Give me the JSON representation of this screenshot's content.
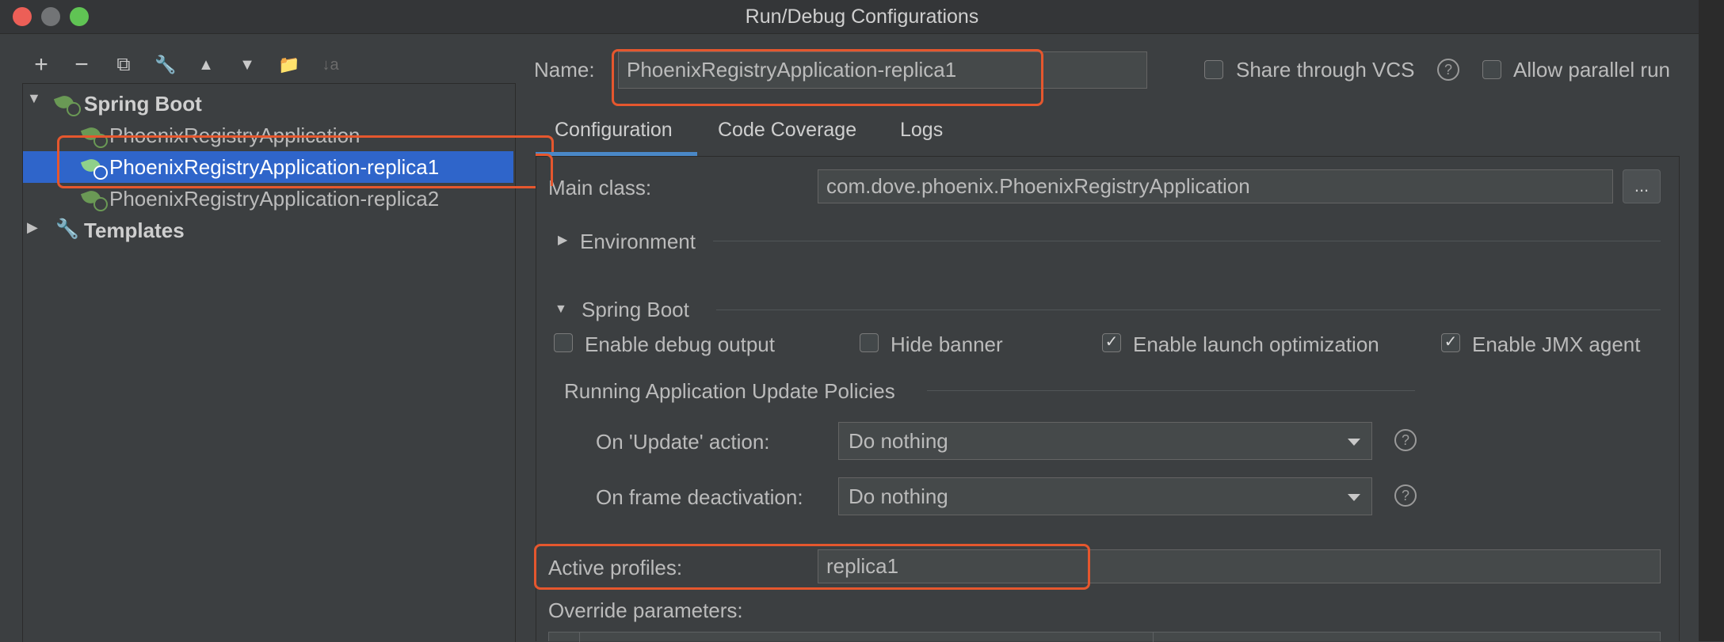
{
  "window": {
    "title": "Run/Debug Configurations"
  },
  "toolbar": {
    "add": "+",
    "remove": "−",
    "copy": "⧉",
    "edit": "🔧",
    "up": "▲",
    "down": "▼",
    "folder": "📁",
    "sort": "↓a"
  },
  "tree": {
    "spring_boot": "Spring Boot",
    "items": [
      "PhoenixRegistryApplication",
      "PhoenixRegistryApplication-replica1",
      "PhoenixRegistryApplication-replica2"
    ],
    "templates": "Templates"
  },
  "name_row": {
    "label": "Name:",
    "value": "PhoenixRegistryApplication-replica1",
    "share_vcs": "Share through VCS",
    "allow_parallel": "Allow parallel run"
  },
  "tabs": [
    "Configuration",
    "Code Coverage",
    "Logs"
  ],
  "main_class": {
    "label": "Main class:",
    "value": "com.dove.phoenix.PhoenixRegistryApplication",
    "browse": "..."
  },
  "environment": "Environment",
  "spring_boot_section": {
    "title": "Spring Boot",
    "enable_debug": "Enable debug output",
    "hide_banner": "Hide banner",
    "launch_opt": "Enable launch optimization",
    "jmx": "Enable JMX agent"
  },
  "policies": {
    "title": "Running Application Update Policies",
    "update_label": "On 'Update' action:",
    "update_value": "Do nothing",
    "frame_label": "On frame deactivation:",
    "frame_value": "Do nothing"
  },
  "active_profiles": {
    "label": "Active profiles:",
    "value": "replica1"
  },
  "override": {
    "label": "Override parameters:"
  },
  "colors": {
    "accent": "#2f65ca",
    "highlight": "#e5572e",
    "bg": "#3c3f41"
  }
}
